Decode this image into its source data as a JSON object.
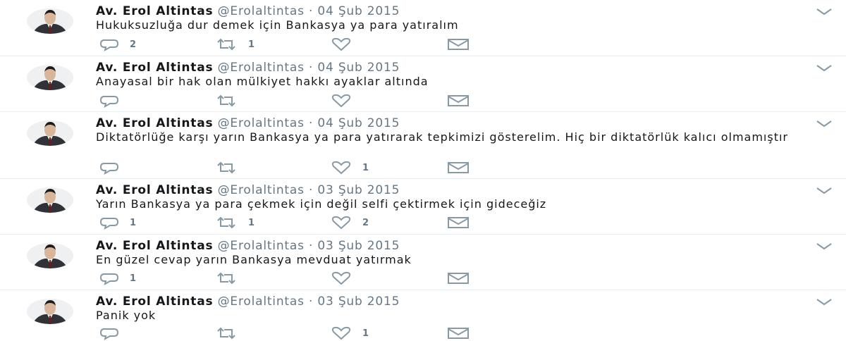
{
  "tweets": [
    {
      "name": "Av. Erol Altintas",
      "handle": "@Erolaltintas",
      "separator": "·",
      "date": "04 Şub 2015",
      "text": "Hukuksuzluğa dur demek için Bankasya ya para yatıralım",
      "reply_count": "2",
      "retweet_count": "1",
      "like_count": ""
    },
    {
      "name": "Av. Erol Altintas",
      "handle": "@Erolaltintas",
      "separator": "·",
      "date": "04 Şub 2015",
      "text": "Anayasal bir hak olan mülkiyet hakkı ayaklar altında",
      "reply_count": "",
      "retweet_count": "",
      "like_count": ""
    },
    {
      "name": "Av. Erol Altintas",
      "handle": "@Erolaltintas",
      "separator": "·",
      "date": "04 Şub 2015",
      "text": "Diktatörlüğe karşı yarın Bankasya ya para yatırarak tepkimizi gösterelim.  Hiç bir diktatörlük kalıcı olmamıştır",
      "reply_count": "",
      "retweet_count": "",
      "like_count": "1"
    },
    {
      "name": "Av. Erol Altintas",
      "handle": "@Erolaltintas",
      "separator": "·",
      "date": "03 Şub 2015",
      "text": "Yarın Bankasya ya para çekmek için değil selfi çektirmek için gideceğiz",
      "reply_count": "1",
      "retweet_count": "1",
      "like_count": "2"
    },
    {
      "name": "Av. Erol Altintas",
      "handle": "@Erolaltintas",
      "separator": "·",
      "date": "03 Şub 2015",
      "text": "En güzel cevap yarın Bankasya mevduat yatırmak",
      "reply_count": "1",
      "retweet_count": "",
      "like_count": ""
    },
    {
      "name": "Av. Erol Altintas",
      "handle": "@Erolaltintas",
      "separator": "·",
      "date": "03 Şub 2015",
      "text": "Panik yok",
      "reply_count": "",
      "retweet_count": "",
      "like_count": "1"
    }
  ],
  "icons": {
    "reply": "reply-icon",
    "retweet": "retweet-icon",
    "like": "heart-icon",
    "message": "envelope-icon",
    "caret": "chevron-down-icon",
    "avatar": "avatar"
  },
  "colors": {
    "name": "#14171a",
    "meta": "#657786",
    "icon": "#8899a6",
    "divider": "#e6ecf0"
  }
}
